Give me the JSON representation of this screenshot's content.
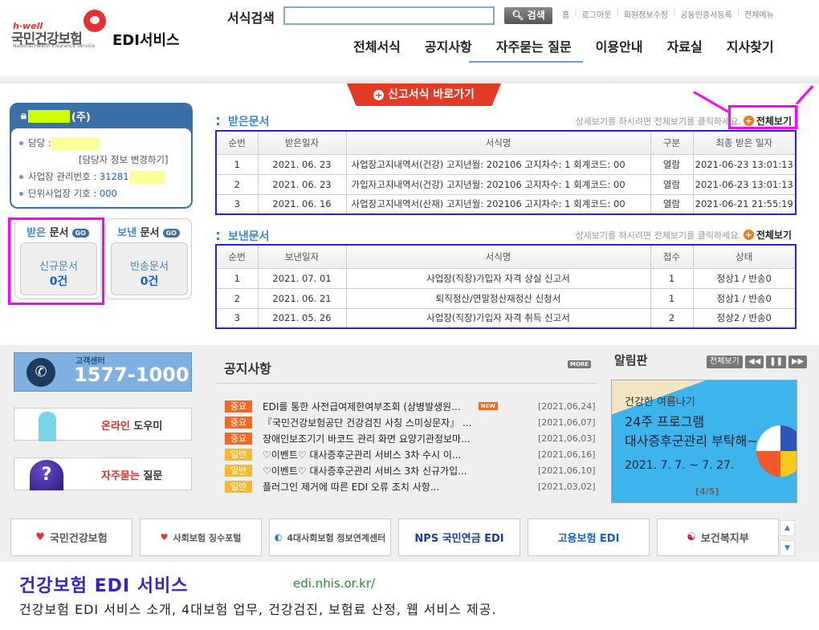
{
  "header": {
    "logo_tag": "h·well",
    "logo_name": "국민건강보험",
    "logo_sub": "National Health Insurance Service",
    "service": "EDI서비스",
    "search_label": "서식검색",
    "search_value": "",
    "search_button": "검색",
    "util": [
      "홈",
      "로그아웃",
      "회원정보수정",
      "공동인증서등록",
      "전체메뉴"
    ],
    "nav": [
      "전체서식",
      "공지사항",
      "자주묻는 질문",
      "이용안내",
      "자료실",
      "지사찾기"
    ]
  },
  "quick_button": "신고서식 바로가기",
  "user": {
    "company_suffix": "(주)",
    "manager_label": "담당 :",
    "change_link": "[담당자 정보 변경하기]",
    "biz_no_label": "사업장 관리번호 :",
    "biz_no": "31281",
    "unit_label": "단위사업장 기호 :",
    "unit_no": "000"
  },
  "received_box": {
    "title_a": "받은",
    "title_b": "문서",
    "go": "GO",
    "label": "신규문서",
    "count": "0건"
  },
  "sent_box": {
    "title_a": "보낸",
    "title_b": "문서",
    "go": "GO",
    "label": "반송문서",
    "count": "0건"
  },
  "received": {
    "title": "받은문서",
    "hint": "상세보기를 하시려면 전체보기를 클릭하세요.",
    "all": "전체보기",
    "columns": [
      "순번",
      "받은일자",
      "서식명",
      "구분",
      "최종 받은 일자"
    ],
    "rows": [
      [
        "1",
        "2021. 06. 23",
        "사업장고지내역서(건강) 고지년월: 202106 고지차수: 1 회계코드: 00",
        "열람",
        "2021-06-23 13:01:13"
      ],
      [
        "2",
        "2021. 06. 23",
        "가입자고지내역서(건강) 고지년월: 202106 고지차수: 1 회계코드: 00",
        "열람",
        "2021-06-23 13:01:13"
      ],
      [
        "3",
        "2021. 06. 16",
        "사업장고지내역서(산재) 고지년월: 202106 고지차수: 1 회계코드: 00",
        "열람",
        "2021-06-21 21:55:19"
      ]
    ]
  },
  "sent": {
    "title": "보낸문서",
    "hint": "상세보기를 하시려면 전체보기를 클릭하세요.",
    "all": "전체보기",
    "columns": [
      "순번",
      "보낸일자",
      "서식명",
      "접수",
      "상태"
    ],
    "rows": [
      [
        "1",
        "2021. 07. 01",
        "사업장(직장)가입자 자격 상실 신고서",
        "1",
        "정상1 / 반송0"
      ],
      [
        "2",
        "2021. 06. 21",
        "퇴직정산/연말정산재정산 신청서",
        "1",
        "정상1 / 반송0"
      ],
      [
        "3",
        "2021. 05. 26",
        "사업장(직장)가입자 자격 취득 신고서",
        "2",
        "정상2 / 반송0"
      ]
    ]
  },
  "customer_center": {
    "label": "고객센터",
    "phone": "1577-1000"
  },
  "help": [
    {
      "red": "온라인",
      "rest": "도우미"
    },
    {
      "red": "자주묻는",
      "rest": "질문"
    }
  ],
  "notice": {
    "title": "공지사항",
    "more": "MORE",
    "new": "NEW",
    "items": [
      {
        "badge": "중요",
        "type": "important",
        "text": "EDI를 통한 사전급여제한여부조회 (상병발생원...",
        "date": "[2021,06,24]"
      },
      {
        "badge": "중요",
        "type": "important",
        "text": "『국민건강보험공단 건강검진 사칭 스미싱문자』 ...",
        "date": "[2021,06,07]"
      },
      {
        "badge": "중요",
        "type": "important",
        "text": "장애인보조기기 바코드 관리 화면 요양기관정보마...",
        "date": "[2021,06,03]"
      },
      {
        "badge": "일반",
        "type": "general",
        "text": "♡이벤트♡ 대사증후군관리 서비스 3차 수시 이...",
        "date": "[2021,06,16]"
      },
      {
        "badge": "일반",
        "type": "general",
        "text": "♡이벤트♡ 대사증후군관리 서비스 3차 신규가입...",
        "date": "[2021,06,10]"
      },
      {
        "badge": "일반",
        "type": "general",
        "text": "플러그인 제거에 따른 EDI 오류 조치 사항...",
        "date": "[2021,03,02]"
      }
    ]
  },
  "alarm": {
    "title": "알림판",
    "all": "전체보기",
    "banner": {
      "line1": "건강한 여름나기",
      "line2": "24주 프로그램",
      "line3": "대사증후군관리 부탁해~",
      "dates": "2021. 7. 7. ~ 7. 27.",
      "page": "[4/5]"
    }
  },
  "partner_logos": [
    "국민건강보험",
    "사회보험 징수포털",
    "4대사회보험 정보연계센터",
    "NPS 국민연금 EDI",
    "고용보험 EDI",
    "보건복지부"
  ],
  "footer": {
    "title": "건강보험 EDI 서비스",
    "url": "edi.nhis.or.kr/",
    "desc": "건강보험 EDI 서비스 소개, 4대보험 업무, 건강검진, 보험료 산정, 웹 서비스 제공."
  },
  "colors": {
    "accent": "#3b6fa8",
    "quick": "#e33a25",
    "annotation": "#ff00ff",
    "table_border": "#2b1ee8"
  }
}
